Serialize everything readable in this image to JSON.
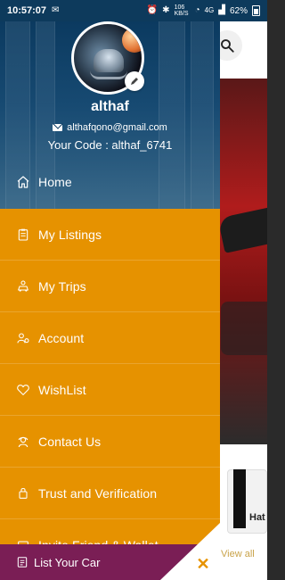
{
  "status_bar": {
    "time": "10:57:07",
    "network_speed": "106 KB/S",
    "signal": "4G",
    "battery": "62%"
  },
  "user": {
    "name": "althaf",
    "email": "althafqono@gmail.com",
    "code_label": "Your Code : althaf_6741"
  },
  "menu": {
    "items": [
      {
        "label": "Home",
        "icon": "home-icon"
      },
      {
        "label": "My Listings",
        "icon": "clipboard-icon"
      },
      {
        "label": "My Trips",
        "icon": "trips-icon"
      },
      {
        "label": "Account",
        "icon": "account-icon"
      },
      {
        "label": "WishList",
        "icon": "heart-icon"
      },
      {
        "label": "Contact Us",
        "icon": "support-icon"
      },
      {
        "label": "Trust and Verification",
        "icon": "shield-icon"
      },
      {
        "label": "Invite Friend & Wallet",
        "icon": "wallet-icon"
      }
    ]
  },
  "footer": {
    "label": "List Your Car",
    "icon": "list-icon",
    "close_icon": "close-icon"
  },
  "background": {
    "card_label": "Hat",
    "view_all": "View all"
  },
  "colors": {
    "drawer": "#e69200",
    "header": "#0b3a60",
    "footer": "#7a1e55",
    "accent": "#e69200"
  }
}
